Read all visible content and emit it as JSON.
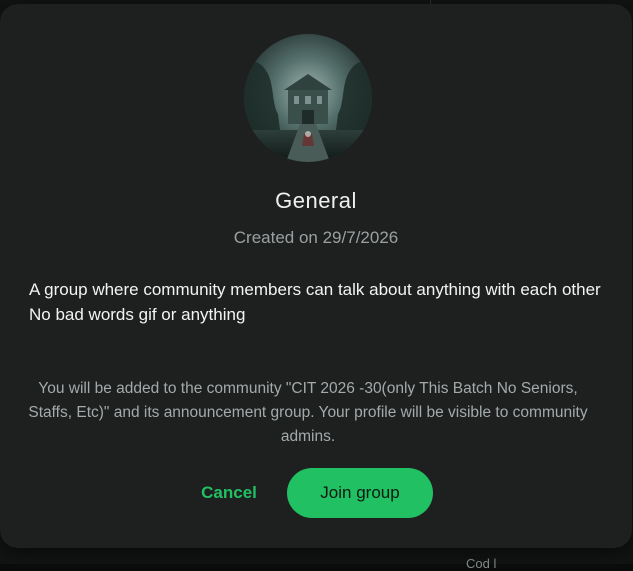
{
  "group": {
    "name": "General",
    "created": "Created on 29/7/2026",
    "description_lines": [
      "A group where community members can talk about anything with each other",
      "No bad words gif or anything"
    ],
    "avatar_icon": "group-photo-haunted-mansion"
  },
  "notice": "You will be added to the community \"CIT 2026 -30(only This Batch No Seniors, Staffs, Etc)\" and its announcement group. Your profile will be visible to community admins.",
  "actions": {
    "cancel_label": "Cancel",
    "join_label": "Join group"
  },
  "background": {
    "peek_text": "Cod   l  "
  },
  "colors": {
    "accent": "#21c063",
    "dialog_bg": "#1e2020",
    "muted_text": "#9aa0a0"
  }
}
